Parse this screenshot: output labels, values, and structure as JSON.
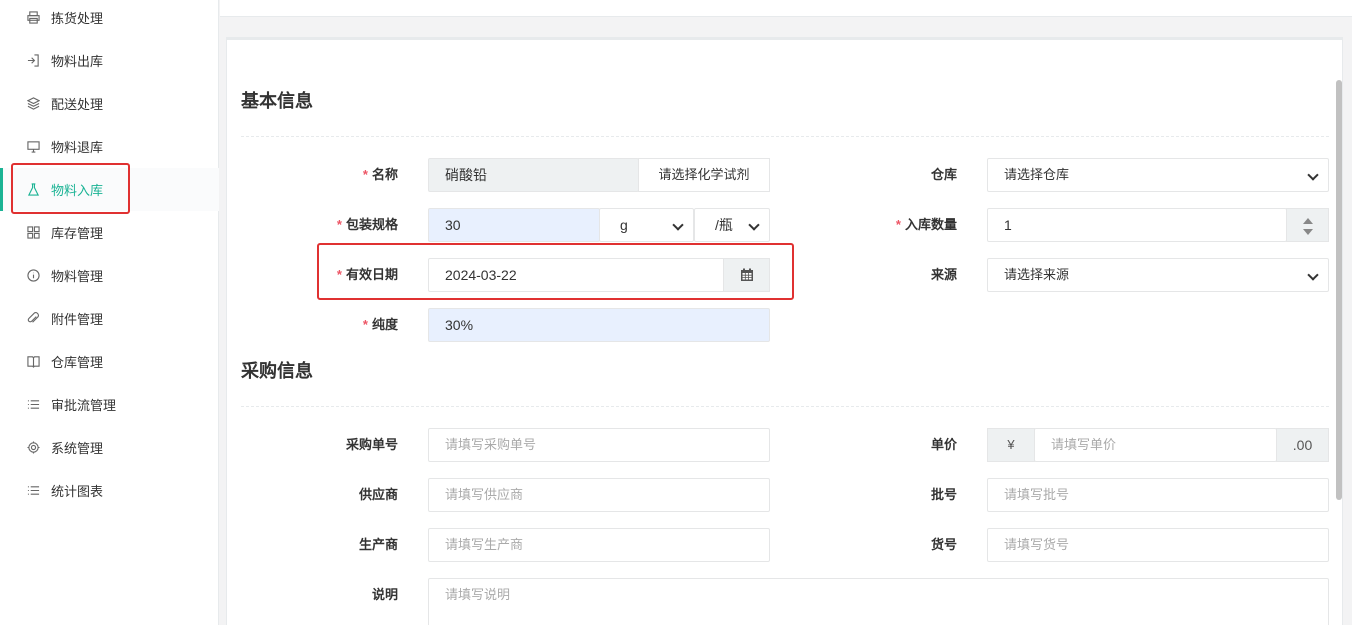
{
  "sidebar": {
    "items": [
      {
        "label": "拣货处理",
        "icon": "printer-icon"
      },
      {
        "label": "物料出库",
        "icon": "sign-out-icon"
      },
      {
        "label": "配送处理",
        "icon": "layers-icon"
      },
      {
        "label": "物料退库",
        "icon": "monitor-icon"
      },
      {
        "label": "物料入库",
        "icon": "flask-icon",
        "active": true
      },
      {
        "label": "库存管理",
        "icon": "grid-icon"
      },
      {
        "label": "物料管理",
        "icon": "info-circle-icon"
      },
      {
        "label": "附件管理",
        "icon": "paperclip-icon"
      },
      {
        "label": "仓库管理",
        "icon": "book-icon"
      },
      {
        "label": "审批流管理",
        "icon": "list-icon"
      },
      {
        "label": "系统管理",
        "icon": "gear-icon"
      },
      {
        "label": "统计图表",
        "icon": "list-icon"
      }
    ]
  },
  "basic": {
    "title": "基本信息",
    "name_label": "名称",
    "name_value": "硝酸铅",
    "name_button": "请选择化学试剂",
    "warehouse_label": "仓库",
    "warehouse_value": "请选择仓库",
    "spec_label": "包装规格",
    "spec_value": "30",
    "spec_unit": "g",
    "spec_pack": "/瓶",
    "qty_label": "入库数量",
    "qty_value": "1",
    "expiry_label": "有效日期",
    "expiry_value": "2024-03-22",
    "source_label": "来源",
    "source_value": "请选择来源",
    "purity_label": "纯度",
    "purity_value": "30%"
  },
  "purchase": {
    "title": "采购信息",
    "order_label": "采购单号",
    "order_placeholder": "请填写采购单号",
    "price_label": "单价",
    "price_prefix": "¥",
    "price_placeholder": "请填写单价",
    "price_suffix": ".00",
    "supplier_label": "供应商",
    "supplier_placeholder": "请填写供应商",
    "batch_label": "批号",
    "batch_placeholder": "请填写批号",
    "maker_label": "生产商",
    "maker_placeholder": "请填写生产商",
    "item_label": "货号",
    "item_placeholder": "请填写货号",
    "note_label": "说明",
    "note_placeholder": "请填写说明"
  },
  "colors": {
    "accent": "#1ab394",
    "required": "#ed5565",
    "highlight": "#e03131"
  }
}
